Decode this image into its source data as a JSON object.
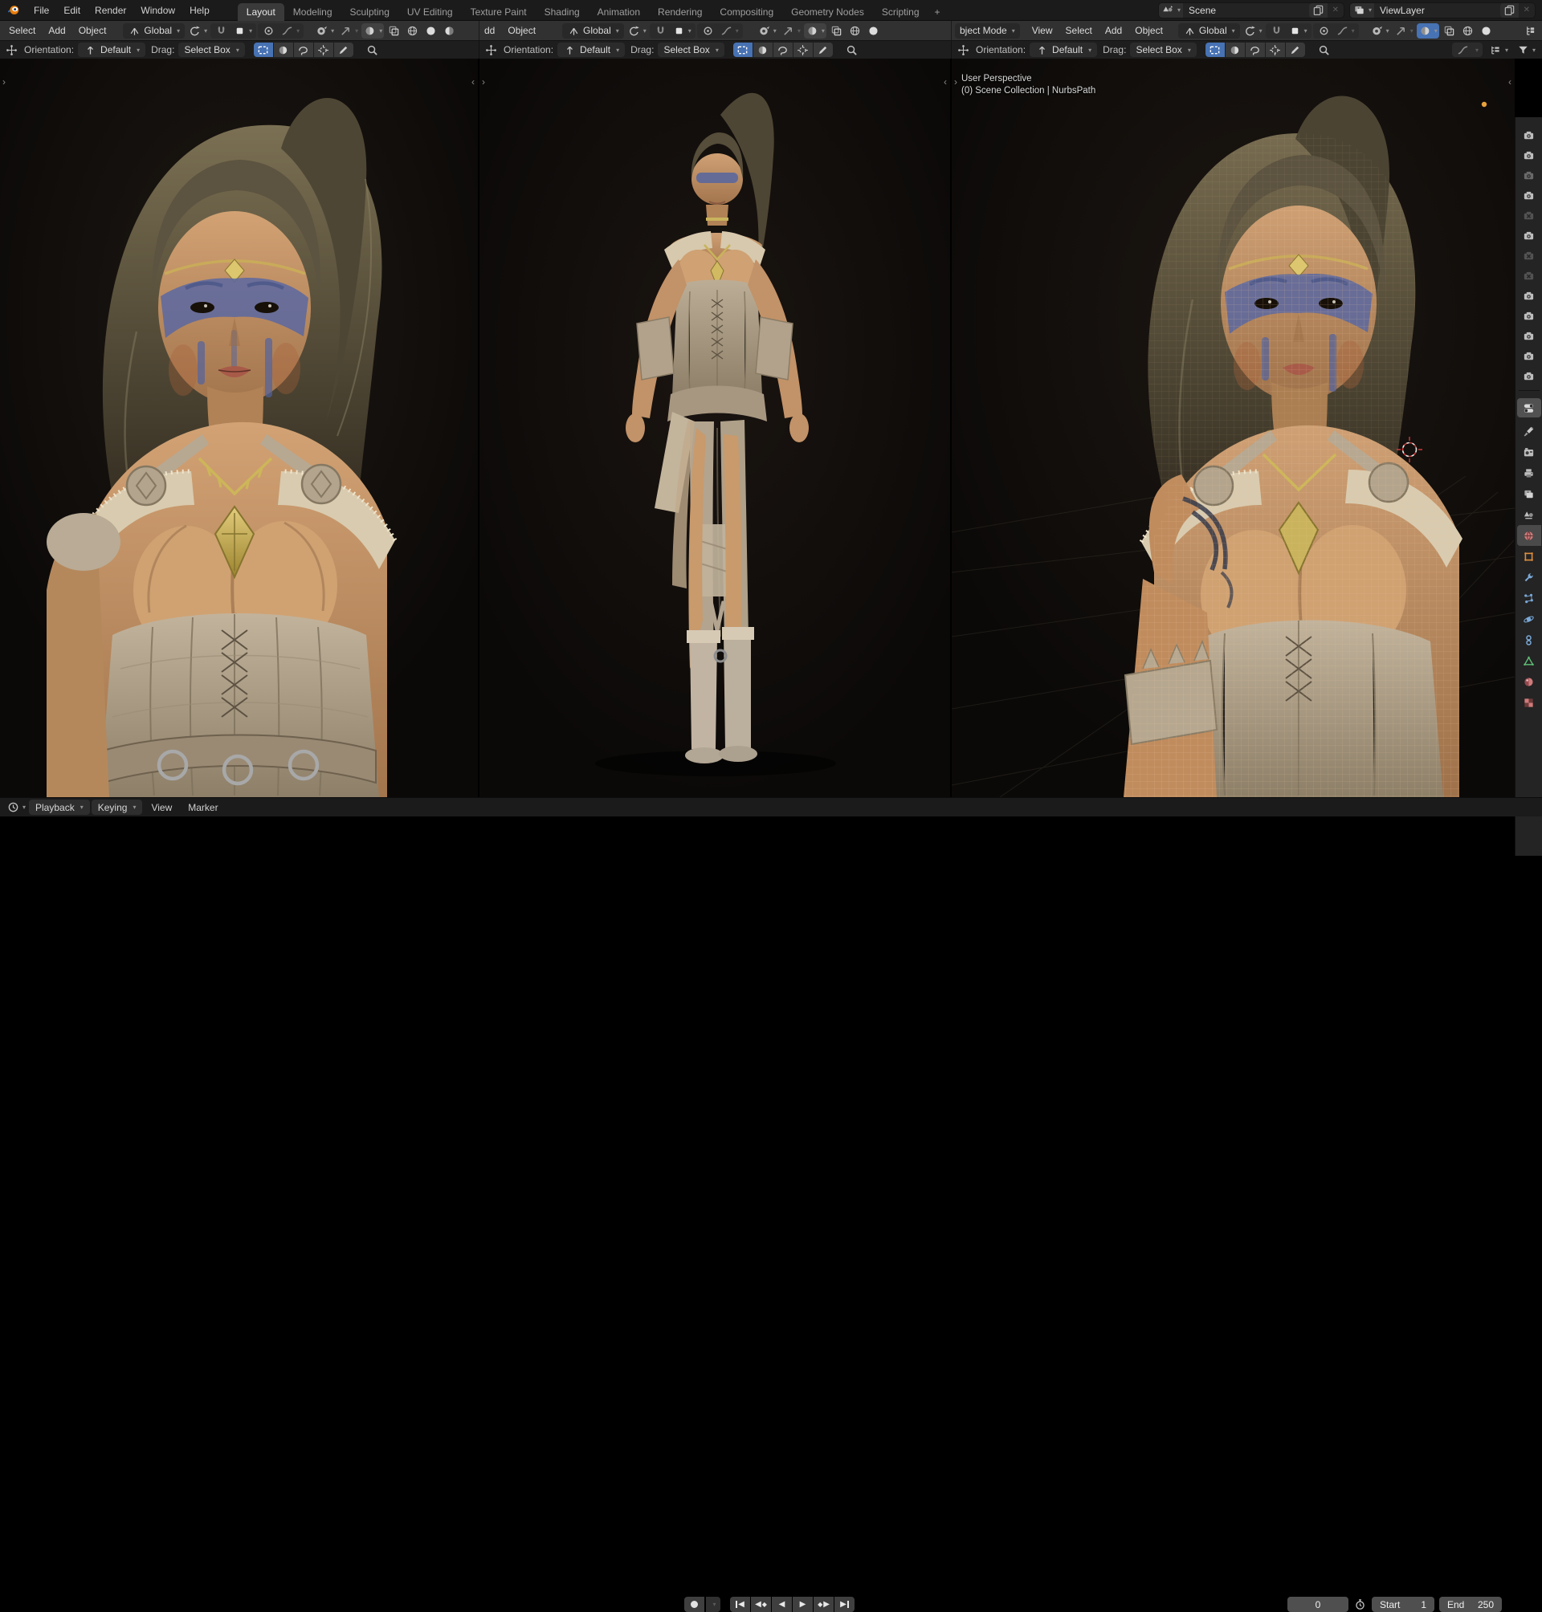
{
  "topbar": {
    "menus": [
      "File",
      "Edit",
      "Render",
      "Window",
      "Help"
    ],
    "workspaces": [
      "Layout",
      "Modeling",
      "Sculpting",
      "UV Editing",
      "Texture Paint",
      "Shading",
      "Animation",
      "Rendering",
      "Compositing",
      "Geometry Nodes",
      "Scripting"
    ],
    "active_workspace": "Layout",
    "new_workspace_label": "+",
    "scene_selector": {
      "value": "Scene"
    },
    "viewlayer_selector": {
      "value": "ViewLayer"
    }
  },
  "viewport1": {
    "menus": [
      "Select",
      "Add",
      "Object"
    ],
    "orientation": "Global"
  },
  "viewport2": {
    "menus": [
      "dd",
      "Object"
    ],
    "orientation": "Global"
  },
  "viewport3": {
    "mode": "bject Mode",
    "menus": [
      "View",
      "Select",
      "Add",
      "Object"
    ],
    "orientation": "Global",
    "overlay_line1": "User Perspective",
    "overlay_line2": "(0) Scene Collection | NurbsPath"
  },
  "tool_settings": {
    "orientation_label": "Orientation:",
    "orientation_value": "Default",
    "drag_label": "Drag:",
    "drag_value": "Select Box"
  },
  "timeline": {
    "menus": [
      "Playback",
      "Keying",
      "View",
      "Marker"
    ],
    "current_frame": "0",
    "start_label": "Start",
    "start_value": "1",
    "end_label": "End",
    "end_value": "250"
  },
  "right_dock": {
    "camera_states": [
      "on",
      "on",
      "dim",
      "on",
      "off",
      "on",
      "off",
      "off",
      "on",
      "on",
      "on",
      "on",
      "on"
    ],
    "properties_tabs": [
      "tool",
      "render",
      "output",
      "view-layer",
      "scene",
      "world",
      "object",
      "modifiers",
      "particles",
      "physics",
      "constraints",
      "object-data",
      "material",
      "texture"
    ],
    "active_tab": "world"
  },
  "icons": {
    "dropdown": "▾",
    "close": "✕",
    "play": "▶",
    "play-reverse": "◀",
    "keyframe": "◆",
    "record": "●"
  },
  "colors": {
    "accent_blue": "#4772b3",
    "header_bg": "#313131",
    "dark_bg": "#1b1b1b",
    "viewport_bg": "#0c0a09"
  }
}
